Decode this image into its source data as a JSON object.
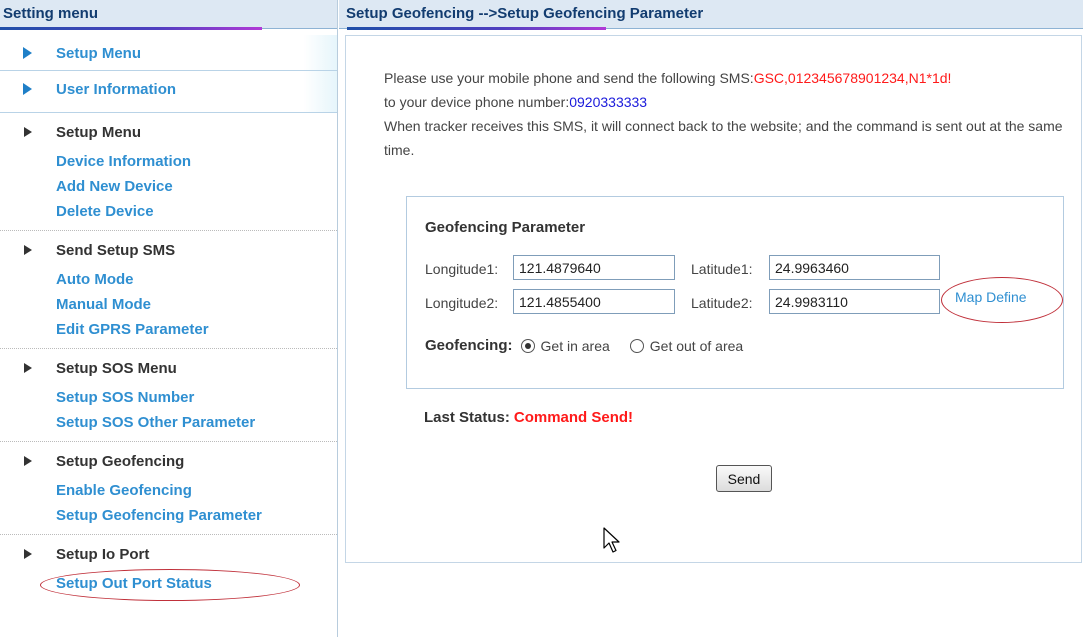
{
  "sidebar": {
    "header": "Setting menu",
    "top_items": [
      "Setup Menu",
      "User Information"
    ],
    "groups": [
      {
        "title": "Setup Menu",
        "items": [
          "Device Information",
          "Add New Device",
          "Delete Device"
        ]
      },
      {
        "title": "Send Setup SMS",
        "items": [
          "Auto Mode",
          "Manual Mode",
          "Edit GPRS Parameter"
        ]
      },
      {
        "title": "Setup SOS Menu",
        "items": [
          "Setup SOS Number",
          "Setup SOS Other Parameter"
        ]
      },
      {
        "title": "Setup Geofencing",
        "items": [
          "Enable Geofencing",
          "Setup Geofencing Parameter"
        ]
      },
      {
        "title": "Setup Io Port",
        "items": [
          "Setup Out Port Status"
        ]
      }
    ]
  },
  "main": {
    "header": "Setup Geofencing -->Setup Geofencing Parameter",
    "intro": {
      "line1_prefix": "Please use your mobile phone and send the following SMS:",
      "sms_command": "GSC,012345678901234,N1*1d!",
      "line2_prefix": "to your device phone number:",
      "phone_number": "0920333333",
      "line3": "When tracker receives this SMS, it will connect back to the website; and the command is sent out at the same time."
    },
    "params": {
      "title": "Geofencing Parameter",
      "longitude1_label": "Longitude1:",
      "longitude1_value": "121.4879640",
      "latitude1_label": "Latitude1:",
      "latitude1_value": "24.9963460",
      "longitude2_label": "Longitude2:",
      "longitude2_value": "121.4855400",
      "latitude2_label": "Latitude2:",
      "latitude2_value": "24.9983110",
      "map_define": "Map Define",
      "geofencing_label": "Geofencing:",
      "option_in": "Get in area",
      "option_out": "Get out of area",
      "selected": "Get in area"
    },
    "status_label": "Last Status:",
    "status_value": "Command Send!",
    "send_label": "Send"
  },
  "colors": {
    "header_bg": "#dde8f3",
    "header_text": "#123c70",
    "link_blue": "#2f8fd1",
    "alert_red": "#ff1a1a",
    "annotation_red": "#c0303a"
  }
}
